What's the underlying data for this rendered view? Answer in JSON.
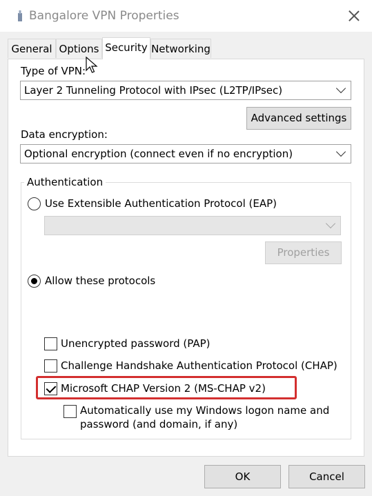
{
  "window": {
    "title": "Bangalore VPN Properties"
  },
  "tabs": [
    {
      "label": "General"
    },
    {
      "label": "Options"
    },
    {
      "label": "Security"
    },
    {
      "label": "Networking"
    }
  ],
  "security": {
    "vpn_type_label": "Type of VPN:",
    "vpn_type_value": "Layer 2 Tunneling Protocol with IPsec (L2TP/IPsec)",
    "advanced_settings_label": "Advanced settings",
    "encryption_label": "Data encryption:",
    "encryption_value": "Optional encryption (connect even if no encryption)",
    "auth_group_label": "Authentication",
    "eap_label": "Use Extensible Authentication Protocol (EAP)",
    "properties_label": "Properties",
    "allow_protocols_label": "Allow these protocols",
    "pap_label": "Unencrypted password (PAP)",
    "chap_label": "Challenge Handshake Authentication Protocol (CHAP)",
    "mschapv2_label": "Microsoft CHAP Version 2 (MS-CHAP v2)",
    "auto_logon_line1": "Automatically use my Windows logon name and",
    "auto_logon_line2": "password (and domain, if any)"
  },
  "state": {
    "active_tab": "Security",
    "eap_selected": false,
    "allow_protocols_selected": true,
    "pap_checked": false,
    "chap_checked": false,
    "mschapv2_checked": true,
    "auto_logon_checked": false
  },
  "footer": {
    "ok_label": "OK",
    "cancel_label": "Cancel"
  },
  "colors": {
    "highlight": "#d32f2f",
    "panel": "#ffffff",
    "dialog": "#f0f0f0"
  }
}
